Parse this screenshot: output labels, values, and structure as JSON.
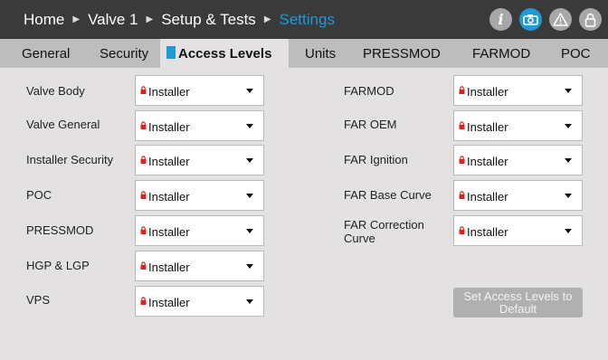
{
  "breadcrumb": [
    "Home",
    "Valve 1",
    "Setup & Tests",
    "Settings"
  ],
  "header_icons": [
    "info-icon",
    "camera-icon",
    "warning-icon",
    "lock-icon"
  ],
  "tabs": [
    "General",
    "Security",
    "Access Levels",
    "Units",
    "PRESSMOD",
    "FARMOD",
    "POC"
  ],
  "active_tab": "Access Levels",
  "left_rows": [
    {
      "label": "Valve Body",
      "value": "Installer"
    },
    {
      "label": "Valve General",
      "value": "Installer"
    },
    {
      "label": "Installer Security",
      "value": "Installer"
    },
    {
      "label": "POC",
      "value": "Installer"
    },
    {
      "label": "PRESSMOD",
      "value": "Installer"
    },
    {
      "label": "HGP & LGP",
      "value": "Installer"
    },
    {
      "label": "VPS",
      "value": "Installer"
    }
  ],
  "right_rows": [
    {
      "label": "FARMOD",
      "value": "Installer"
    },
    {
      "label": "FAR OEM",
      "value": "Installer"
    },
    {
      "label": "FAR Ignition",
      "value": "Installer"
    },
    {
      "label": "FAR Base Curve",
      "value": "Installer"
    },
    {
      "label": "FAR Correction Curve",
      "value": "Installer"
    }
  ],
  "default_button": "Set Access Levels to Default",
  "colors": {
    "accent": "#1e9ad6",
    "lock": "#e02020",
    "header": "#3a3a3a",
    "tabbar": "#bdbdbd",
    "background": "#e3e1e1"
  }
}
